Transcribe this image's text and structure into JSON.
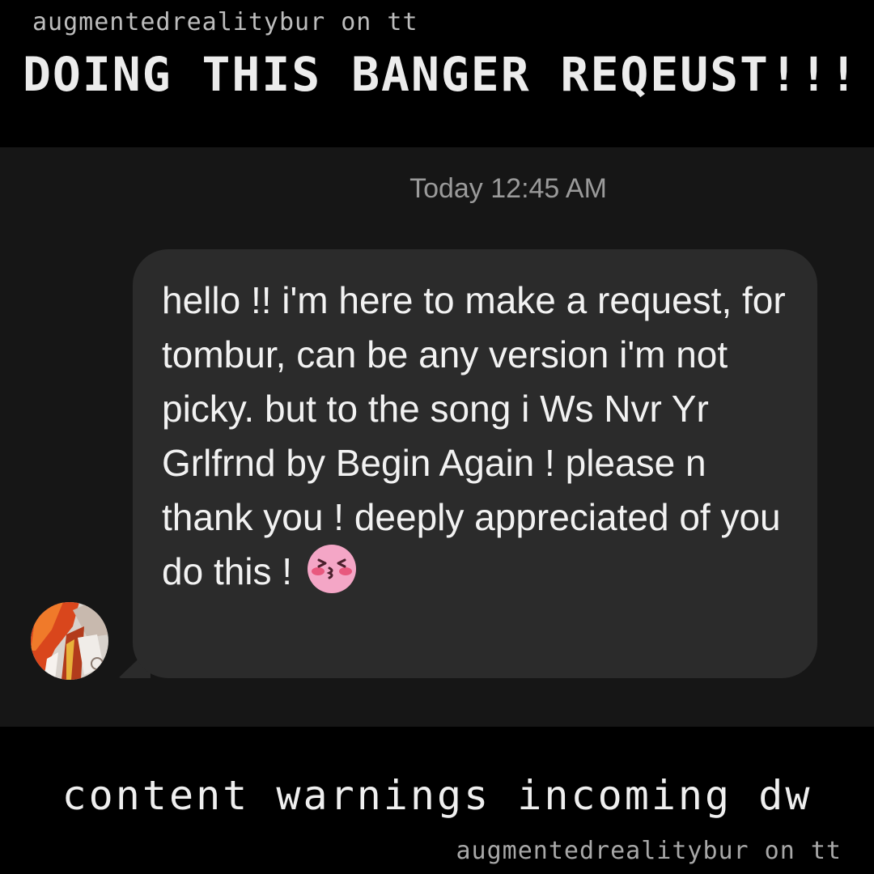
{
  "overlay": {
    "watermark_top": "augmentedrealitybur on tt",
    "headline": "DOING THIS BANGER REQEUST!!!",
    "content_warning": "content warnings incoming dw",
    "watermark_bottom": "augmentedrealitybur on tt"
  },
  "chat": {
    "timestamp": "Today 12:45 AM",
    "message": {
      "text": "hello !! i'm here to make a request, for tombur, can be any version i'm not picky. but to the song i Ws Nvr Yr Grlfrnd by Begin Again ! please n thank you ! deeply appreciated of you do this !",
      "emoji": "kissing-face-emoji"
    },
    "avatar": "sender-avatar"
  },
  "colors": {
    "page_background": "#000000",
    "chat_background": "#161616",
    "bubble_background": "#2b2b2b",
    "timestamp_text": "#9a9a9a",
    "message_text": "#f2f2f2"
  }
}
